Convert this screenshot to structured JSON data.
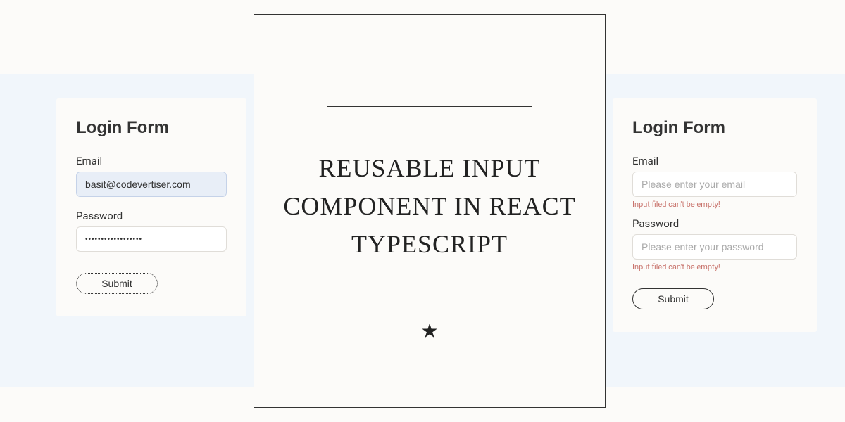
{
  "leftForm": {
    "title": "Login Form",
    "emailLabel": "Email",
    "emailValue": "basit@codevertiser.com",
    "passwordLabel": "Password",
    "passwordValue": "••••••••••••••••••",
    "submitLabel": "Submit"
  },
  "rightForm": {
    "title": "Login Form",
    "emailLabel": "Email",
    "emailPlaceholder": "Please enter your email",
    "emailError": "Input filed can't be empty!",
    "passwordLabel": "Password",
    "passwordPlaceholder": "Please enter your password",
    "passwordError": "Input filed can't be empty!",
    "submitLabel": "Submit"
  },
  "centerPanel": {
    "title": "REUSABLE INPUT COMPONENT IN REACT TYPESCRIPT",
    "starIcon": "★"
  }
}
